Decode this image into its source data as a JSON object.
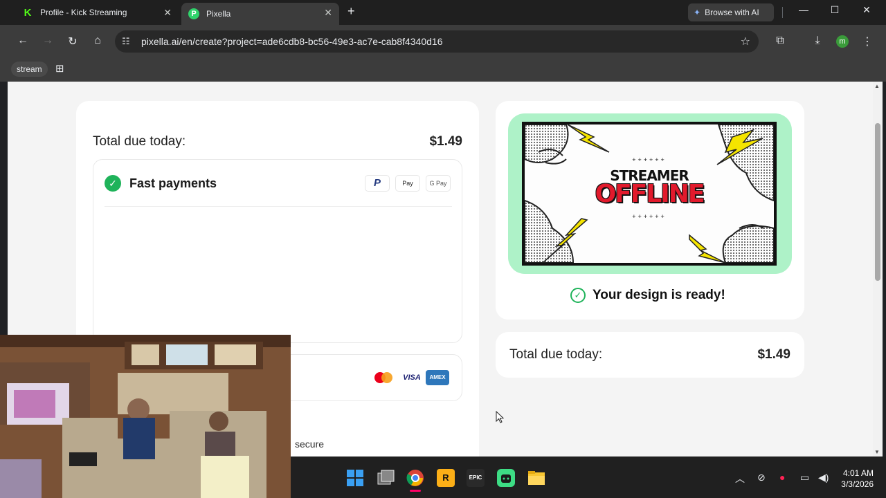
{
  "browser": {
    "tabs": [
      {
        "title": "Profile - Kick Streaming",
        "favicon": "K"
      },
      {
        "title": "Pixella",
        "favicon": "P"
      }
    ],
    "new_tab": "+",
    "browse_ai_label": "Browse with AI",
    "url": "pixella.ai/en/create?project=ade6cdb8-bc56-49e3-ac7e-cab8f4340d16",
    "profile_initial": "m",
    "bookmarks": [
      {
        "label": "stream"
      }
    ]
  },
  "checkout": {
    "total_label": "Total due today:",
    "total_amount": "$1.49",
    "fast_payments_label": "Fast payments",
    "fast_payment_methods": [
      "PayPal",
      "Apple Pay",
      "Google Pay"
    ],
    "apple_pay_text": "Pay",
    "google_pay_text": "G Pay",
    "card_brands": [
      "Mastercard",
      "VISA",
      "AMEX"
    ],
    "visa_text": "VISA",
    "amex_text": "AMEX",
    "secure_text": "secure"
  },
  "preview": {
    "image_line1": "STREAMER",
    "image_line2": "OFFLINE",
    "image_dots": "++++++",
    "ready_text": "Your design is ready!",
    "total_label": "Total due today:",
    "total_amount": "$1.49"
  },
  "taskbar": {
    "apps": [
      "start",
      "task-view",
      "chrome",
      "rockstar-launcher",
      "epic-games",
      "android-app",
      "file-explorer"
    ],
    "rockstar_text": "R",
    "epic_text": "EPIC",
    "time": "4:01 AM",
    "date": "3/3/2026"
  },
  "colors": {
    "accent_green": "#1fb35a",
    "preview_frame": "#aef2c8",
    "offline_red": "#e21a2c",
    "chrome_dark": "#3c3c3c"
  }
}
